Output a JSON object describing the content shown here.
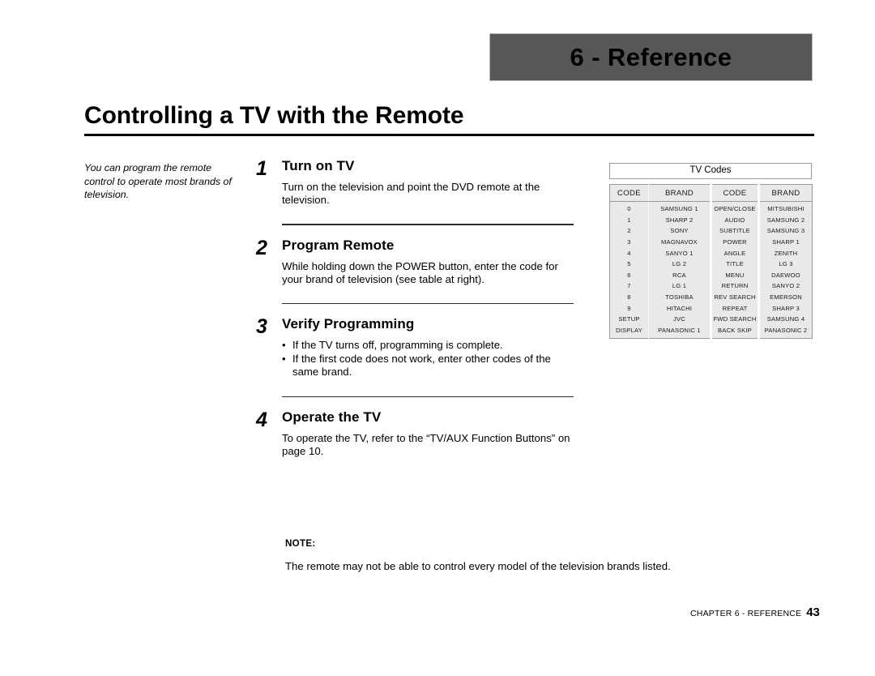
{
  "chapter_banner": {
    "label": "6 - Reference",
    "bg_color": "#575757"
  },
  "page_title": "Controlling a TV with the Remote",
  "side_note": "You can program the remote control to operate most brands of television.",
  "steps": [
    {
      "number": "1",
      "heading": "Turn on TV",
      "body": "Turn on the television and point the DVD remote at the television."
    },
    {
      "number": "2",
      "heading": "Program Remote",
      "body": "While holding down the POWER button, enter the code for your brand of television (see table at right)."
    },
    {
      "number": "3",
      "heading": "Verify Programming",
      "bullets": [
        "If the TV turns off, programming is complete.",
        "If the first code does not work, enter other codes of the same brand."
      ]
    },
    {
      "number": "4",
      "heading": "Operate the TV",
      "body": "To operate the TV, refer to the “TV/AUX Function Buttons” on page 10."
    }
  ],
  "tv_codes": {
    "title": "TV Codes",
    "headers": [
      "CODE",
      "BRAND",
      "CODE",
      "BRAND"
    ],
    "rows": [
      [
        "0",
        "SAMSUNG 1",
        "OPEN/CLOSE",
        "MITSUBISHI"
      ],
      [
        "1",
        "SHARP 2",
        "AUDIO",
        "SAMSUNG 2"
      ],
      [
        "2",
        "SONY",
        "SUBTITLE",
        "SAMSUNG 3"
      ],
      [
        "3",
        "MAGNAVOX",
        "POWER",
        "SHARP 1"
      ],
      [
        "4",
        "SANYO 1",
        "ANGLE",
        "ZENITH"
      ],
      [
        "5",
        "LG 2",
        "TITLE",
        "LG 3"
      ],
      [
        "6",
        "RCA",
        "MENU",
        "DAEWOO"
      ],
      [
        "7",
        "LG 1",
        "RETURN",
        "SANYO 2"
      ],
      [
        "8",
        "TOSHIBA",
        "REV SEARCH",
        "EMERSON"
      ],
      [
        "9",
        "HITACHI",
        "REPEAT",
        "SHARP 3"
      ],
      [
        "SETUP",
        "JVC",
        "FWD SEARCH",
        "SAMSUNG 4"
      ],
      [
        "DISPLAY",
        "PANASONIC 1",
        "BACK SKIP",
        "PANASONIC 2"
      ]
    ]
  },
  "note": {
    "label": "NOTE:",
    "text": "The remote may not be able to control every model of the television brands listed."
  },
  "footer": {
    "chapter": "CHAPTER 6 - REFERENCE",
    "page": "43"
  }
}
